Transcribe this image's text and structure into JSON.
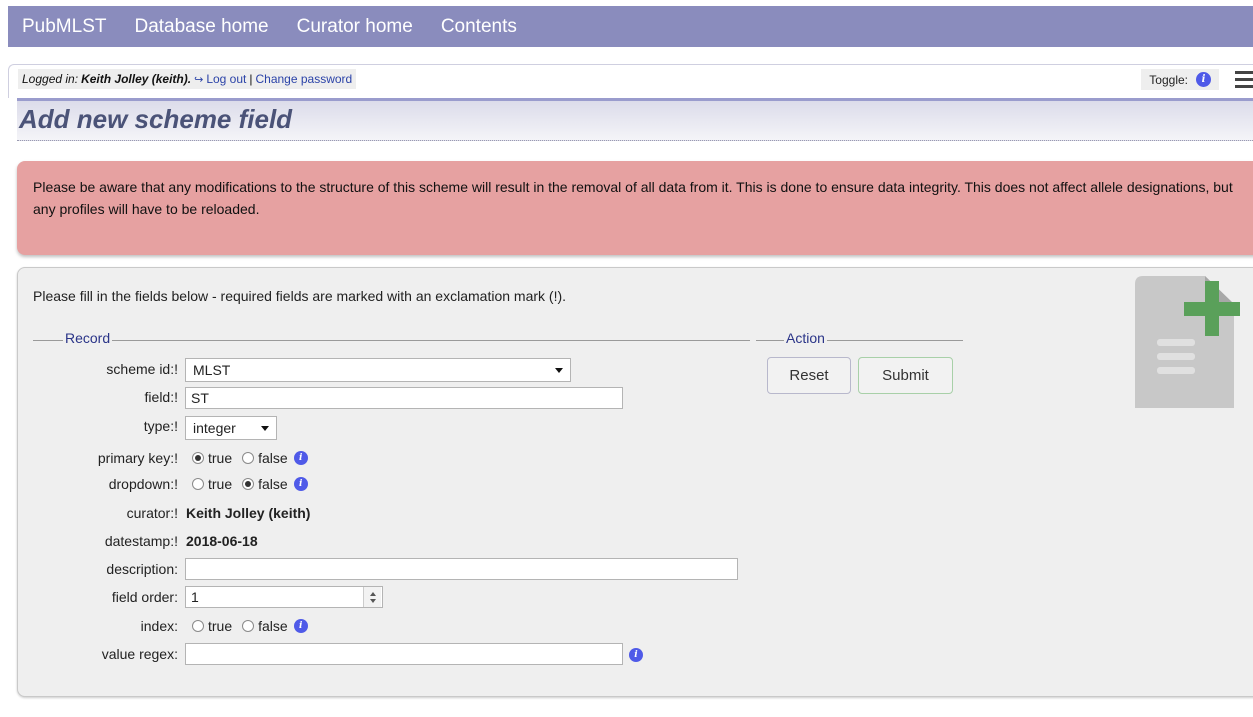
{
  "nav": {
    "items": [
      "PubMLST",
      "Database home",
      "Curator home",
      "Contents"
    ]
  },
  "login": {
    "prefix": "Logged in:",
    "user": "Keith Jolley (keith).",
    "logout": "Log out",
    "separator": "|",
    "change_password": "Change password"
  },
  "toggle": {
    "label": "Toggle:"
  },
  "page_title": "Add new scheme field",
  "warning": {
    "text": "Please be aware that any modifications to the structure of this scheme will result in the removal of all data from it. This is done to ensure data integrity. This does not affect allele designations, but any profiles will have to be reloaded."
  },
  "form": {
    "intro": "Please fill in the fields below - required fields are marked with an exclamation mark (!).",
    "record_legend": "Record",
    "action_legend": "Action",
    "fields": {
      "scheme_id": {
        "label": "scheme id:!",
        "value": "MLST"
      },
      "field": {
        "label": "field:!",
        "value": "ST"
      },
      "type": {
        "label": "type:!",
        "value": "integer"
      },
      "primary_key": {
        "label": "primary key:!",
        "true_label": "true",
        "false_label": "false",
        "selected": "true"
      },
      "dropdown": {
        "label": "dropdown:!",
        "true_label": "true",
        "false_label": "false",
        "selected": "false"
      },
      "curator": {
        "label": "curator:!",
        "value": "Keith Jolley (keith)"
      },
      "datestamp": {
        "label": "datestamp:!",
        "value": "2018-06-18"
      },
      "description": {
        "label": "description:",
        "value": ""
      },
      "field_order": {
        "label": "field order:",
        "value": "1"
      },
      "index": {
        "label": "index:",
        "true_label": "true",
        "false_label": "false",
        "selected": ""
      },
      "value_regex": {
        "label": "value regex:",
        "value": ""
      }
    },
    "buttons": {
      "reset": "Reset",
      "submit": "Submit"
    }
  },
  "colors": {
    "nav_bg": "#8a8cbd",
    "warning_bg": "#e6a1a1",
    "info_icon": "#4f5ae8",
    "add_icon_green": "#5aa05a"
  },
  "icons": {
    "logout": "sign-out-icon",
    "info": "info-circle-icon",
    "menu": "hamburger-menu-icon",
    "add_document": "document-plus-icon"
  }
}
